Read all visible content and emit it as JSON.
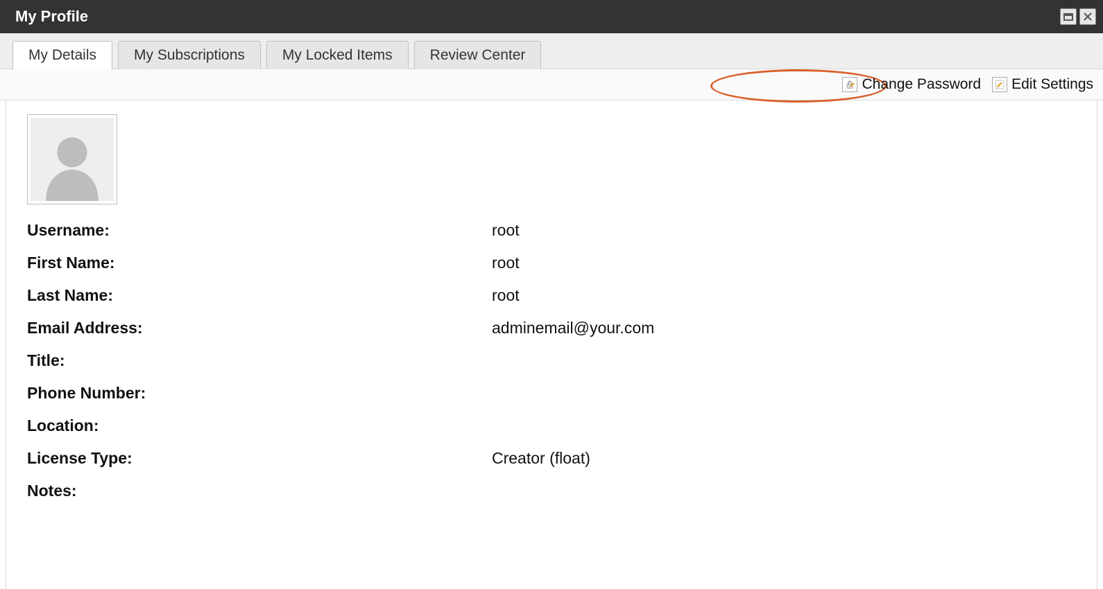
{
  "window": {
    "title": "My Profile"
  },
  "tabs": [
    {
      "label": "My Details",
      "active": true
    },
    {
      "label": "My Subscriptions",
      "active": false
    },
    {
      "label": "My Locked Items",
      "active": false
    },
    {
      "label": "Review Center",
      "active": false
    }
  ],
  "toolbar": {
    "change_password_label": "Change Password",
    "edit_settings_label": "Edit Settings"
  },
  "profile": {
    "avatar_icon": "person-silhouette-icon",
    "fields": [
      {
        "label": "Username:",
        "value": "root"
      },
      {
        "label": "First Name:",
        "value": "root"
      },
      {
        "label": "Last Name:",
        "value": "root"
      },
      {
        "label": "Email Address:",
        "value": "adminemail@your.com"
      },
      {
        "label": "Title:",
        "value": ""
      },
      {
        "label": "Phone Number:",
        "value": ""
      },
      {
        "label": "Location:",
        "value": ""
      },
      {
        "label": "License Type:",
        "value": "Creator (float)"
      },
      {
        "label": "Notes:",
        "value": ""
      }
    ]
  },
  "annotation": {
    "highlighted_action": "change_password"
  }
}
